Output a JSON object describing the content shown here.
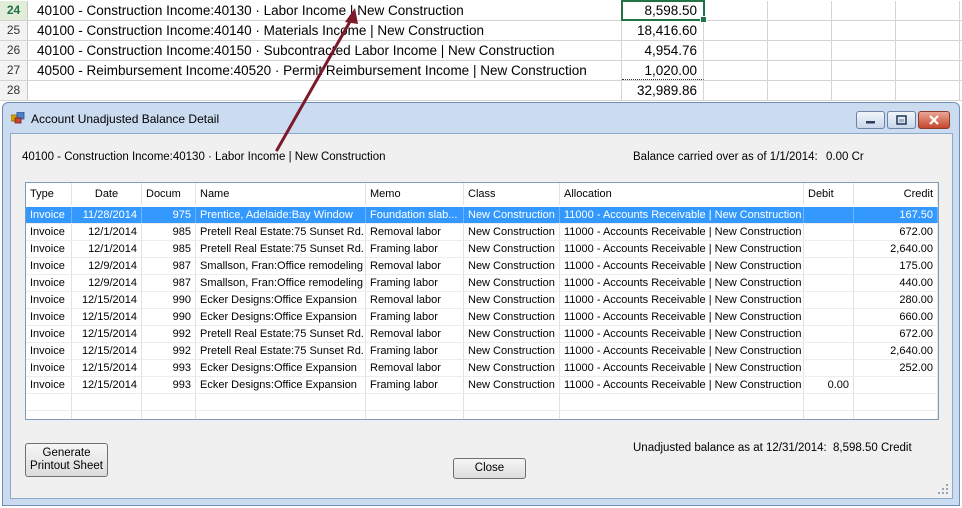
{
  "sheet": {
    "rows": [
      {
        "num": "24",
        "account": "40100 - Construction Income:40130 · Labor Income | New Construction",
        "amount": "8,598.50",
        "active": true
      },
      {
        "num": "25",
        "account": "40100 - Construction Income:40140 · Materials Income | New Construction",
        "amount": "18,416.60",
        "active": false
      },
      {
        "num": "26",
        "account": "40100 - Construction Income:40150 · Subcontracted Labor Income | New Construction",
        "amount": "4,954.76",
        "active": false
      },
      {
        "num": "27",
        "account": "40500 - Reimbursement Income:40520 · Permit Reimbursement Income | New Construction",
        "amount": "1,020.00",
        "active": false
      },
      {
        "num": "28",
        "account": "",
        "amount": "32,989.86",
        "active": false
      }
    ]
  },
  "dialog": {
    "title": "Account Unadjusted Balance Detail",
    "account_label": "40100 - Construction Income:40130 · Labor Income | New Construction",
    "balance_carried_label": "Balance carried over as of 1/1/2014:",
    "balance_carried_value": "0.00 Cr",
    "columns": [
      "Type",
      "Date",
      "Docum",
      "Name",
      "Memo",
      "Class",
      "Allocation",
      "Debit",
      "Credit"
    ],
    "rows": [
      {
        "type": "Invoice",
        "date": "11/28/2014",
        "doc": "975",
        "name": "Prentice, Adelaide:Bay Window",
        "memo": "Foundation slab...",
        "class": "New Construction",
        "allocation": "11000 - Accounts Receivable | New Construction",
        "debit": "",
        "credit": "167.50",
        "selected": true
      },
      {
        "type": "Invoice",
        "date": "12/1/2014",
        "doc": "985",
        "name": "Pretell Real Estate:75 Sunset Rd.",
        "memo": "Removal labor",
        "class": "New Construction",
        "allocation": "11000 - Accounts Receivable | New Construction",
        "debit": "",
        "credit": "672.00"
      },
      {
        "type": "Invoice",
        "date": "12/1/2014",
        "doc": "985",
        "name": "Pretell Real Estate:75 Sunset Rd.",
        "memo": "Framing labor",
        "class": "New Construction",
        "allocation": "11000 - Accounts Receivable | New Construction",
        "debit": "",
        "credit": "2,640.00"
      },
      {
        "type": "Invoice",
        "date": "12/9/2014",
        "doc": "987",
        "name": "Smallson, Fran:Office remodeling",
        "memo": "Removal labor",
        "class": "New Construction",
        "allocation": "11000 - Accounts Receivable | New Construction",
        "debit": "",
        "credit": "175.00"
      },
      {
        "type": "Invoice",
        "date": "12/9/2014",
        "doc": "987",
        "name": "Smallson, Fran:Office remodeling",
        "memo": "Framing labor",
        "class": "New Construction",
        "allocation": "11000 - Accounts Receivable | New Construction",
        "debit": "",
        "credit": "440.00"
      },
      {
        "type": "Invoice",
        "date": "12/15/2014",
        "doc": "990",
        "name": "Ecker Designs:Office Expansion",
        "memo": "Removal labor",
        "class": "New Construction",
        "allocation": "11000 - Accounts Receivable | New Construction",
        "debit": "",
        "credit": "280.00"
      },
      {
        "type": "Invoice",
        "date": "12/15/2014",
        "doc": "990",
        "name": "Ecker Designs:Office Expansion",
        "memo": "Framing labor",
        "class": "New Construction",
        "allocation": "11000 - Accounts Receivable | New Construction",
        "debit": "",
        "credit": "660.00"
      },
      {
        "type": "Invoice",
        "date": "12/15/2014",
        "doc": "992",
        "name": "Pretell Real Estate:75 Sunset Rd.",
        "memo": "Removal labor",
        "class": "New Construction",
        "allocation": "11000 - Accounts Receivable | New Construction",
        "debit": "",
        "credit": "672.00"
      },
      {
        "type": "Invoice",
        "date": "12/15/2014",
        "doc": "992",
        "name": "Pretell Real Estate:75 Sunset Rd.",
        "memo": "Framing labor",
        "class": "New Construction",
        "allocation": "11000 - Accounts Receivable | New Construction",
        "debit": "",
        "credit": "2,640.00"
      },
      {
        "type": "Invoice",
        "date": "12/15/2014",
        "doc": "993",
        "name": "Ecker Designs:Office Expansion",
        "memo": "Removal labor",
        "class": "New Construction",
        "allocation": "11000 - Accounts Receivable | New Construction",
        "debit": "",
        "credit": "252.00"
      },
      {
        "type": "Invoice",
        "date": "12/15/2014",
        "doc": "993",
        "name": "Ecker Designs:Office Expansion",
        "memo": "Framing labor",
        "class": "New Construction",
        "allocation": "11000 - Accounts Receivable | New Construction",
        "debit": "0.00",
        "credit": ""
      }
    ],
    "generate_button": "Generate Printout Sheet",
    "close_button": "Close",
    "unadjusted_label": "Unadjusted balance as at 12/31/2014:",
    "unadjusted_value": "8,598.50 Credit"
  },
  "colors": {
    "selection": "#3399ff",
    "excel_green": "#217346",
    "arrow": "#7b1a2a"
  }
}
